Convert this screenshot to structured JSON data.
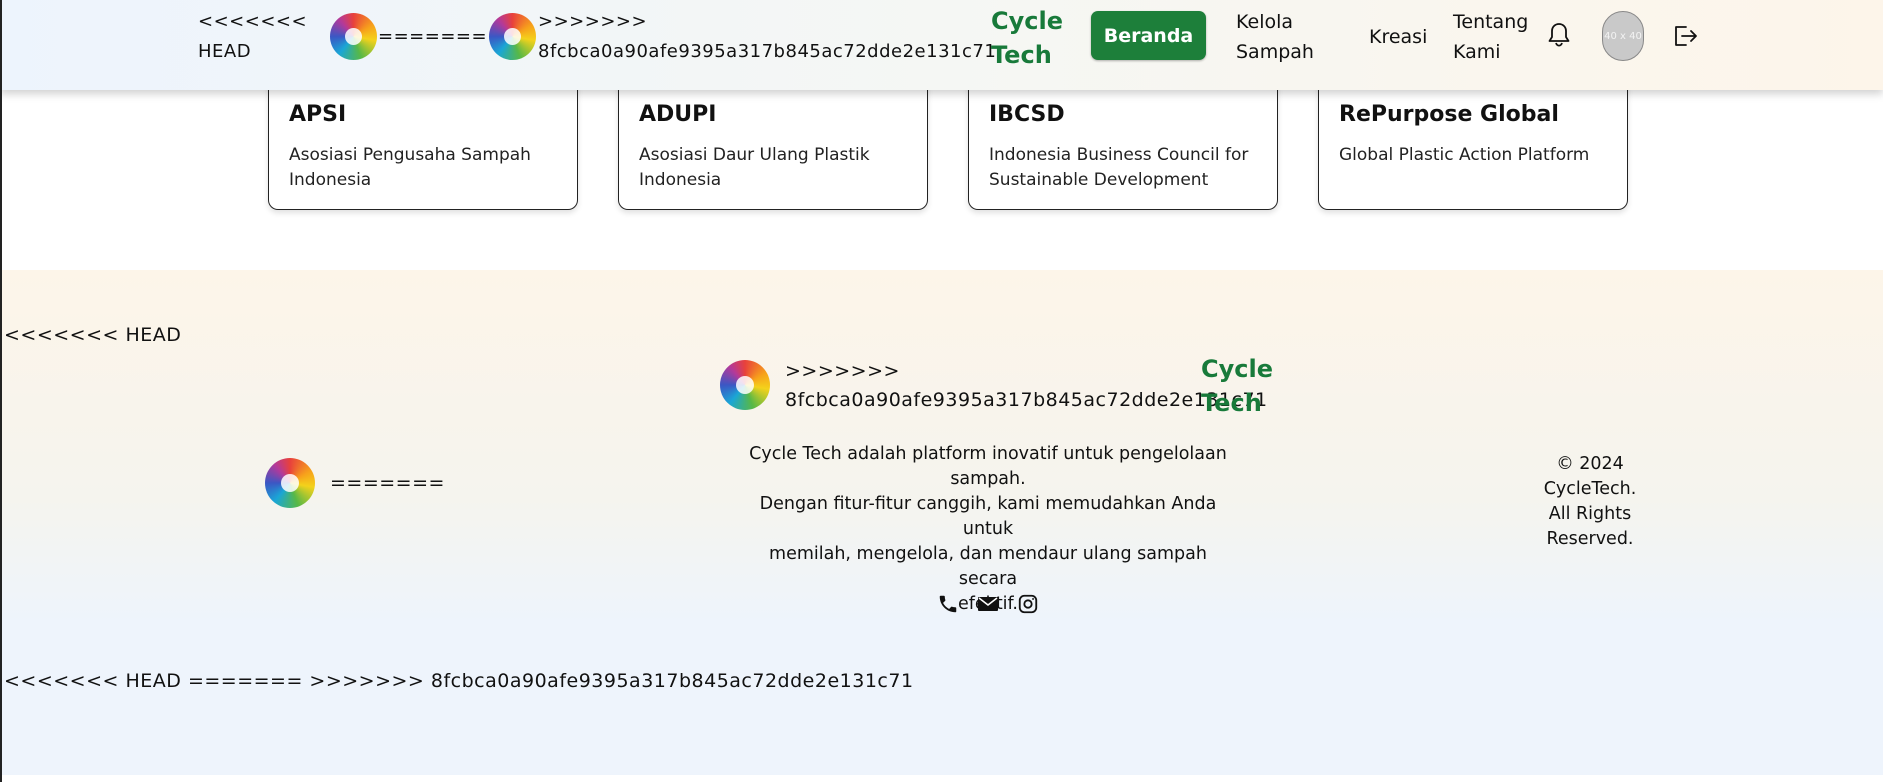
{
  "header": {
    "conflict_head": "<<<<<<< HEAD",
    "conflict_sep": "=======",
    "conflict_end": ">>>>>>>",
    "conflict_hash": "8fcbca0a90afe9395a317b845ac72dde2e131c71",
    "brand_line1": "Cycle",
    "brand_line2": "Tech",
    "nav_beranda": "Beranda",
    "nav_kelola_1": "Kelola",
    "nav_kelola_2": "Sampah",
    "nav_kreasi": "Kreasi",
    "nav_tentang_1": "Tentang",
    "nav_tentang_2": "Kami",
    "avatar_placeholder": "40 x 40",
    "icons": [
      "bell-icon",
      "logout-icon"
    ]
  },
  "partners": [
    {
      "name": "APSI",
      "desc_1": "Asosiasi Pengusaha Sampah",
      "desc_2": "Indonesia"
    },
    {
      "name": "ADUPI",
      "desc_1": "Asosiasi Daur Ulang Plastik",
      "desc_2": "Indonesia"
    },
    {
      "name": "IBCSD",
      "desc_1": "Indonesia Business Council for",
      "desc_2": "Sustainable Development"
    },
    {
      "name": "RePurpose Global",
      "desc_1": "Global Plastic Action Platform",
      "desc_2": ""
    }
  ],
  "footer": {
    "conflict_head": "<<<<<<< HEAD",
    "conflict_sep": "=======",
    "conflict_end": ">>>>>>>",
    "conflict_hash": "8fcbca0a90afe9395a317b845ac72dde2e131c71",
    "brand_line1": "Cycle",
    "brand_line2": "Tech",
    "desc_1": "Cycle Tech adalah platform inovatif untuk pengelolaan",
    "desc_2": "sampah.",
    "desc_3": "Dengan fitur-fitur canggih, kami memudahkan Anda untuk",
    "desc_4": "memilah, mengelola, dan mendaur ulang sampah secara",
    "desc_5": "efektif.",
    "copyright_1": "© 2024",
    "copyright_2": "CycleTech.",
    "copyright_3": "All Rights",
    "copyright_4": "Reserved.",
    "bottom_conflict": "<<<<<<< HEAD ======= >>>>>>> 8fcbca0a90afe9395a317b845ac72dde2e131c71",
    "social_icons": [
      "phone-icon",
      "mail-icon",
      "instagram-icon"
    ]
  },
  "colors": {
    "brand_green": "#187a3a",
    "button_green": "#1d7f3a"
  }
}
